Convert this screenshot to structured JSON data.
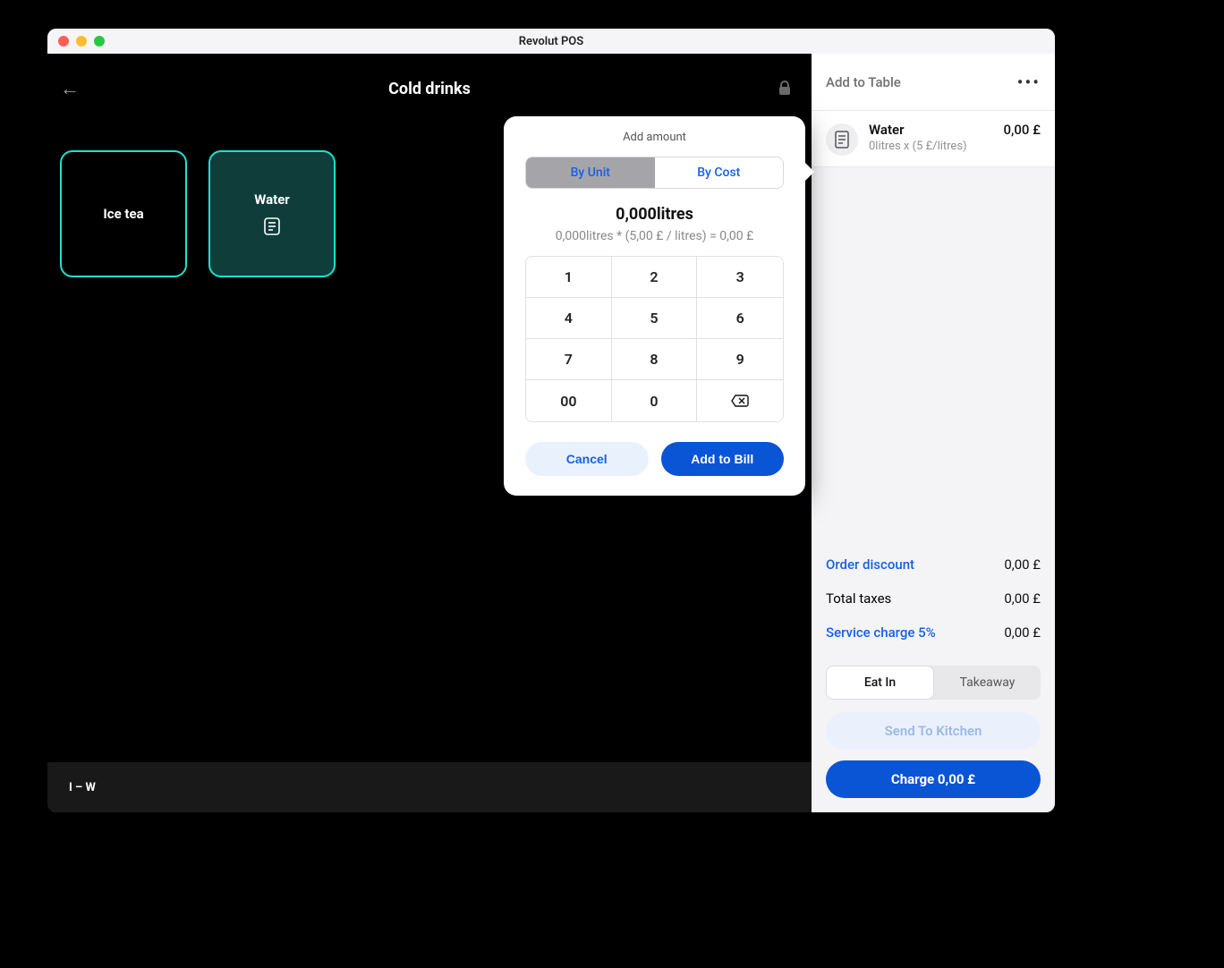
{
  "window": {
    "title": "Revolut POS"
  },
  "main": {
    "category_title": "Cold drinks",
    "tiles": [
      {
        "label": "Ice tea"
      },
      {
        "label": "Water"
      }
    ],
    "filter_range": "I – W"
  },
  "popover": {
    "title": "Add amount",
    "tabs": {
      "byUnit": "By Unit",
      "byCost": "By Cost"
    },
    "amount_display": "0,000litres",
    "amount_expression": "0,000litres * (5,00 £ / litres) = 0,00 £",
    "keys": [
      "1",
      "2",
      "3",
      "4",
      "5",
      "6",
      "7",
      "8",
      "9",
      "00",
      "0",
      "⌫"
    ],
    "cancel": "Cancel",
    "add": "Add to Bill"
  },
  "sidebar": {
    "header_title": "Add to Table",
    "item": {
      "name": "Water",
      "subtitle": "0litres x (5 £/litres)",
      "price": "0,00 £"
    },
    "totals": {
      "order_discount_label": "Order discount",
      "order_discount_value": "0,00 £",
      "taxes_label": "Total taxes",
      "taxes_value": "0,00 £",
      "service_label": "Service charge 5%",
      "service_value": "0,00 £"
    },
    "dining": {
      "eat_in": "Eat In",
      "takeaway": "Takeaway"
    },
    "send_kitchen": "Send To Kitchen",
    "charge_label": "Charge 0,00 £"
  }
}
